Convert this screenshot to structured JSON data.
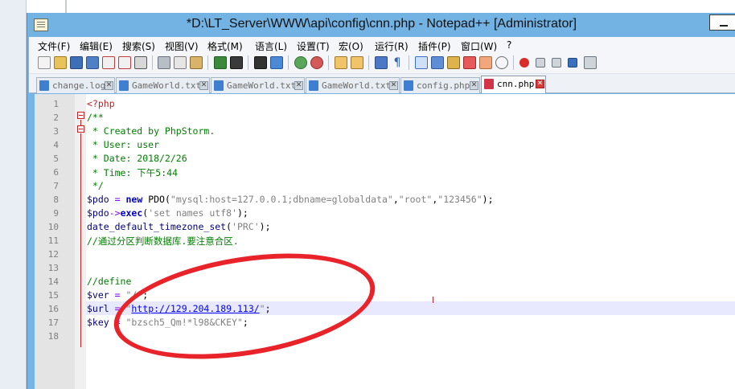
{
  "window": {
    "title": "*D:\\LT_Server\\WWW\\api\\config\\cnn.php - Notepad++ [Administrator]"
  },
  "menu": [
    "文件(F)",
    "编辑(E)",
    "搜索(S)",
    "视图(V)",
    "格式(M)",
    "语言(L)",
    "设置(T)",
    "宏(O)",
    "运行(R)",
    "插件(P)",
    "窗口(W)",
    "?"
  ],
  "tabs": [
    {
      "label": "change.log",
      "active": false
    },
    {
      "label": "GameWorld.txt",
      "active": false
    },
    {
      "label": "GameWorld.txt",
      "active": false
    },
    {
      "label": "GameWorld.txt",
      "active": false
    },
    {
      "label": "config.php",
      "active": false
    },
    {
      "label": "cnn.php",
      "active": true
    }
  ],
  "tab_close_glyph": "✕",
  "line_numbers": [
    "1",
    "2",
    "3",
    "4",
    "5",
    "6",
    "7",
    "8",
    "9",
    "10",
    "11",
    "12",
    "13",
    "14",
    "15",
    "16",
    "17",
    "18"
  ],
  "code": {
    "l1": "<?php",
    "l2": "/**",
    "l3": " * Created by PhpStorm.",
    "l4": " * User: user",
    "l5": " * Date: 2018/2/26",
    "l6": " * Time: 下午5:44",
    "l7": " */",
    "l8": {
      "var": "$pdo",
      "eq": " = ",
      "kw": "new",
      "cls": " PDO(",
      "s1": "\"mysql:host=127.0.0.1;dbname=globaldata\"",
      "c1": ",",
      "s2": "\"root\"",
      "c2": ",",
      "s3": "\"123456\"",
      "end": ");"
    },
    "l9": {
      "var": "$pdo",
      "arrow": "->",
      "fn": "exec",
      "p": "(",
      "s": "'set names utf8'",
      "end": ");"
    },
    "l10": {
      "fn": "date_default_timezone_set",
      "p": "(",
      "s": "'PRC'",
      "end": ");"
    },
    "l11": "//通过分区判断数据库.要注意合区.",
    "l14": "//define",
    "l15": {
      "var": "$ver",
      "eq": " = ",
      "s": "\"/\"",
      "end": ";"
    },
    "l16": {
      "var": "$url",
      "eq": " = ",
      "q1": "\"",
      "link": "http://129.204.189.113/",
      "q2": "\"",
      "end": ";"
    },
    "l17": {
      "var": "$key",
      "eq": " = ",
      "s": "\"bzsch5_Qm!*l98&CKEY\"",
      "end": ";"
    }
  },
  "colors": {
    "annotation_circle": "#e8242a",
    "title_bar": "#72b3e4",
    "current_line": "#e8e8ff"
  }
}
